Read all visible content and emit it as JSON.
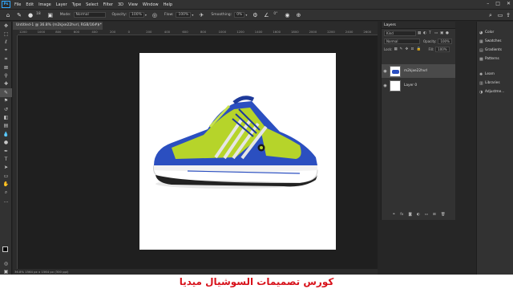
{
  "menubar": {
    "logo": "Ps",
    "items": [
      "File",
      "Edit",
      "Image",
      "Layer",
      "Type",
      "Select",
      "Filter",
      "3D",
      "View",
      "Window",
      "Help"
    ]
  },
  "options": {
    "brush_size": "18",
    "mode_label": "Mode:",
    "mode_value": "Normal",
    "opacity_label": "Opacity:",
    "opacity_value": "100%",
    "flow_label": "Flow:",
    "flow_value": "100%",
    "smoothing_label": "Smoothing:",
    "smoothing_value": "0%",
    "angle_value": "0°"
  },
  "document": {
    "tab_title": "Untitled-1 @ 36.8% (m2kjxe22hvrl, RGB/16#) *",
    "status": "36.8%  1564 px x 1564 px (300 ppi)",
    "ruler_ticks": [
      "1200",
      "1000",
      "800",
      "600",
      "400",
      "200",
      "0",
      "200",
      "400",
      "600",
      "800",
      "1000",
      "1200",
      "1400",
      "1600",
      "1800",
      "2000",
      "2200",
      "2400",
      "2600"
    ]
  },
  "layers_panel": {
    "title": "Layers",
    "search_placeholder": "Kind",
    "blend_mode": "Normal",
    "opacity_label": "Opacity:",
    "opacity_value": "100%",
    "lock_label": "Lock:",
    "fill_label": "Fill:",
    "fill_value": "100%",
    "layers": [
      {
        "name": "m2kjxe22hvrl",
        "selected": true
      },
      {
        "name": "Layer 0",
        "selected": false
      }
    ]
  },
  "right_panel": {
    "group1": [
      {
        "label": "Color",
        "icon": "color-wheel-icon"
      },
      {
        "label": "Swatches",
        "icon": "grid-icon"
      },
      {
        "label": "Gradients",
        "icon": "gradient-icon"
      },
      {
        "label": "Patterns",
        "icon": "pattern-icon"
      }
    ],
    "group2": [
      {
        "label": "Learn",
        "icon": "bulb-icon"
      },
      {
        "label": "Libraries",
        "icon": "library-icon"
      },
      {
        "label": "Adjustme...",
        "icon": "adjust-icon"
      }
    ]
  },
  "caption": "كورس تصميمات السوشيال ميديا",
  "colors": {
    "accent": "#31a8ff",
    "caption_red": "#d8121b",
    "shoe_blue": "#2b4fc0",
    "shoe_green": "#b6d42a"
  }
}
